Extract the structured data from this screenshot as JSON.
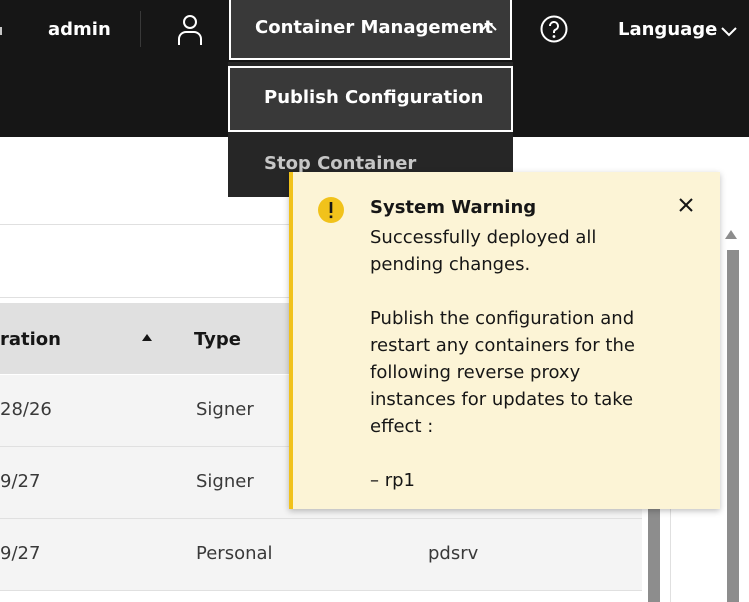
{
  "header": {
    "username": "admin",
    "menu_label": "Container Management",
    "language_label": "Language"
  },
  "dropdown": {
    "items": [
      {
        "label": "Publish Configuration"
      },
      {
        "label": "Stop Container"
      }
    ]
  },
  "table": {
    "headers": {
      "configuration": "ration",
      "type": "Type"
    },
    "rows": [
      {
        "date": "28/26",
        "type": "Signer",
        "extra": ""
      },
      {
        "date": "9/27",
        "type": "Signer",
        "extra": ""
      },
      {
        "date": "9/27",
        "type": "Personal",
        "extra": "pdsrv"
      }
    ]
  },
  "notification": {
    "title": "System Warning",
    "message": "Successfully deployed all pending changes.",
    "detail": "Publish the configuration and restart any containers for the following reverse proxy instances for updates to take effect :",
    "instances": [
      "–  rp1"
    ]
  },
  "colors": {
    "warning": "#f1c21b",
    "notification_bg": "#fcf4d6",
    "header_bg": "#161616"
  }
}
